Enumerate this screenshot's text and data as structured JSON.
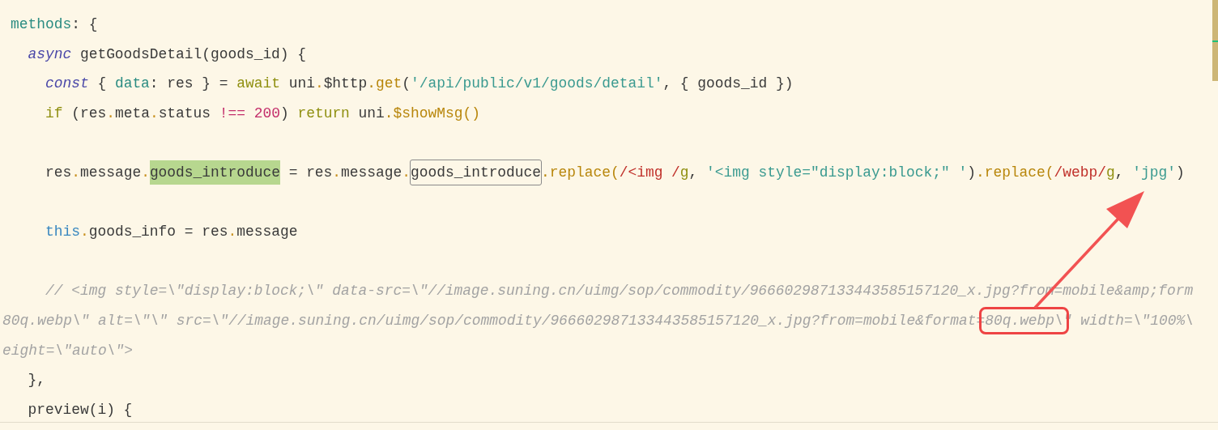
{
  "editor": {
    "lines": [
      {
        "kind": "code",
        "tokens": [
          {
            "kind": "property",
            "text": "methods"
          },
          {
            "kind": "plain",
            "text": ": {"
          }
        ],
        "children": [
          {
            "kind": "code",
            "tokens": [
              {
                "kind": "keyword",
                "text": "async"
              },
              {
                "kind": "plain",
                "text": " getGoodsDetail(goods_id) {"
              }
            ],
            "children": [
              {
                "kind": "code",
                "tokens": [
                  {
                    "kind": "keyword",
                    "text": "const"
                  },
                  {
                    "kind": "plain",
                    "text": " { "
                  },
                  {
                    "kind": "property",
                    "text": "data"
                  },
                  {
                    "kind": "plain",
                    "text": ": res } = "
                  },
                  {
                    "kind": "control",
                    "text": "await"
                  },
                  {
                    "kind": "plain",
                    "text": " uni"
                  },
                  {
                    "kind": "dot",
                    "text": "."
                  },
                  {
                    "kind": "plain",
                    "text": "$http"
                  },
                  {
                    "kind": "function",
                    "text": ".get"
                  },
                  {
                    "kind": "plain",
                    "text": "("
                  },
                  {
                    "kind": "string",
                    "text": "'/api/public/v1/goods/detail'"
                  },
                  {
                    "kind": "plain",
                    "text": ", { goods_id })"
                  }
                ]
              },
              {
                "kind": "code",
                "tokens": [
                  {
                    "kind": "control",
                    "text": "if"
                  },
                  {
                    "kind": "plain",
                    "text": " (res"
                  },
                  {
                    "kind": "dot",
                    "text": "."
                  },
                  {
                    "kind": "plain",
                    "text": "meta"
                  },
                  {
                    "kind": "dot",
                    "text": "."
                  },
                  {
                    "kind": "plain",
                    "text": "status "
                  },
                  {
                    "kind": "operator",
                    "text": "!=="
                  },
                  {
                    "kind": "number",
                    "text": " 200"
                  },
                  {
                    "kind": "plain",
                    "text": ") "
                  },
                  {
                    "kind": "control",
                    "text": "return"
                  },
                  {
                    "kind": "plain",
                    "text": " uni"
                  },
                  {
                    "kind": "function",
                    "text": ".$showMsg()"
                  }
                ]
              },
              {
                "kind": "blank"
              },
              {
                "kind": "code",
                "tokens": [
                  {
                    "kind": "plain",
                    "text": "res"
                  },
                  {
                    "kind": "dot",
                    "text": "."
                  },
                  {
                    "kind": "plain",
                    "text": "message"
                  },
                  {
                    "kind": "dot",
                    "text": "."
                  },
                  {
                    "kind": "plain",
                    "text": "goods_introduce",
                    "highlighted": true
                  },
                  {
                    "kind": "plain",
                    "text": " = res"
                  },
                  {
                    "kind": "dot",
                    "text": "."
                  },
                  {
                    "kind": "plain",
                    "text": "message"
                  },
                  {
                    "kind": "dot",
                    "text": "."
                  },
                  {
                    "kind": "plain",
                    "text": "goods_introduce",
                    "boxed": true
                  },
                  {
                    "kind": "function",
                    "text": ".replace("
                  },
                  {
                    "kind": "regex",
                    "text": "/<img /"
                  },
                  {
                    "kind": "flag",
                    "text": "g"
                  },
                  {
                    "kind": "plain",
                    "text": ", "
                  },
                  {
                    "kind": "string",
                    "text": "'<img style=\"display:block;\" '"
                  },
                  {
                    "kind": "plain",
                    "text": ")"
                  },
                  {
                    "kind": "function",
                    "text": ".replace("
                  },
                  {
                    "kind": "regex",
                    "text": "/webp/"
                  },
                  {
                    "kind": "flag",
                    "text": "g"
                  },
                  {
                    "kind": "plain",
                    "text": ", "
                  },
                  {
                    "kind": "string",
                    "text": "'jpg'"
                  },
                  {
                    "kind": "plain",
                    "text": ")"
                  }
                ]
              },
              {
                "kind": "blank"
              },
              {
                "kind": "code",
                "tokens": [
                  {
                    "kind": "builtin",
                    "text": "this"
                  },
                  {
                    "kind": "dot",
                    "text": "."
                  },
                  {
                    "kind": "plain",
                    "text": "goods_info = res"
                  },
                  {
                    "kind": "dot",
                    "text": "."
                  },
                  {
                    "kind": "plain",
                    "text": "message"
                  }
                ]
              },
              {
                "kind": "blank"
              },
              {
                "kind": "code",
                "tokens": [
                  {
                    "kind": "comment",
                    "text": "// <img style=\\\"display:block;\\\" data-src=\\\"//image.suning.cn/uimg/sop/commodity/966602987133443585157120_x.jpg?from=mobile&amp;form"
                  }
                ]
              },
              {
                "kind": "wrap",
                "tokens": [
                  {
                    "kind": "comment",
                    "text": "80q.webp\\\" alt=\\\"\\\" src=\\\"//image.suning.cn/uimg/sop/commodity/966602987133443585157120_x.jpg?from=mobile&format="
                  },
                  {
                    "kind": "comment",
                    "text": "80q.webp\\",
                    "annotated": true
                  },
                  {
                    "kind": "comment",
                    "text": "\" width=\\\"100%\\"
                  }
                ]
              },
              {
                "kind": "wrap",
                "tokens": [
                  {
                    "kind": "comment",
                    "text": "eight=\\\"auto\\\">"
                  }
                ]
              }
            ]
          },
          {
            "kind": "code",
            "tokens": [
              {
                "kind": "plain",
                "text": "},"
              }
            ]
          },
          {
            "kind": "code",
            "tokens": [
              {
                "kind": "plain",
                "text": "preview(i) {"
              }
            ]
          }
        ]
      }
    ]
  }
}
